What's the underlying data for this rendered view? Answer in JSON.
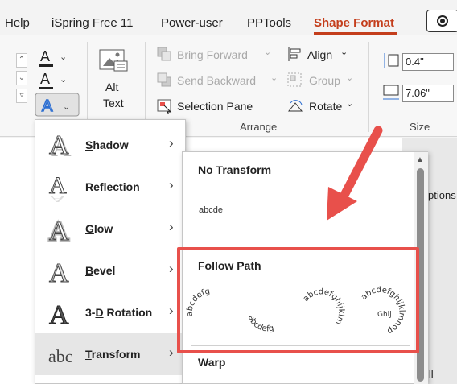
{
  "ribbon_tabs": {
    "help": "Help",
    "ispring": "iSpring Free 11",
    "power_user": "Power-user",
    "pptools": "PPTools",
    "shape_format": "Shape Format"
  },
  "ribbon": {
    "alt_text_line1": "Alt",
    "alt_text_line2": "Text",
    "bring_forward": "Bring Forward",
    "send_backward": "Send Backward",
    "selection_pane": "Selection Pane",
    "align": "Align",
    "group": "Group",
    "rotate": "Rotate",
    "arrange_label": "Arrange",
    "height_value": "0.4\"",
    "width_value": "7.06\"",
    "size_label": "Size",
    "options_partial": "ptions",
    "fill_partial": "ill"
  },
  "text_effects_menu": {
    "items": [
      {
        "label": "Shadow",
        "accel_before": "",
        "accel": "S",
        "accel_after": "hadow"
      },
      {
        "label": "Reflection",
        "accel_before": "",
        "accel": "R",
        "accel_after": "eflection"
      },
      {
        "label": "Glow",
        "accel_before": "",
        "accel": "G",
        "accel_after": "low"
      },
      {
        "label": "Bevel",
        "accel_before": "",
        "accel": "B",
        "accel_after": "evel"
      },
      {
        "label": "3-D Rotation",
        "accel_before": "3-",
        "accel": "D",
        "accel_after": " Rotation"
      },
      {
        "label": "Transform",
        "accel_before": "",
        "accel": "T",
        "accel_after": "ransform"
      }
    ]
  },
  "transform_submenu": {
    "no_transform_heading": "No Transform",
    "no_transform_sample": "abcde",
    "follow_path_heading": "Follow Path",
    "warp_heading": "Warp"
  },
  "colors": {
    "accent": "#c43e1c",
    "highlight_box": "#e8504b",
    "arrow": "#e8504b"
  }
}
